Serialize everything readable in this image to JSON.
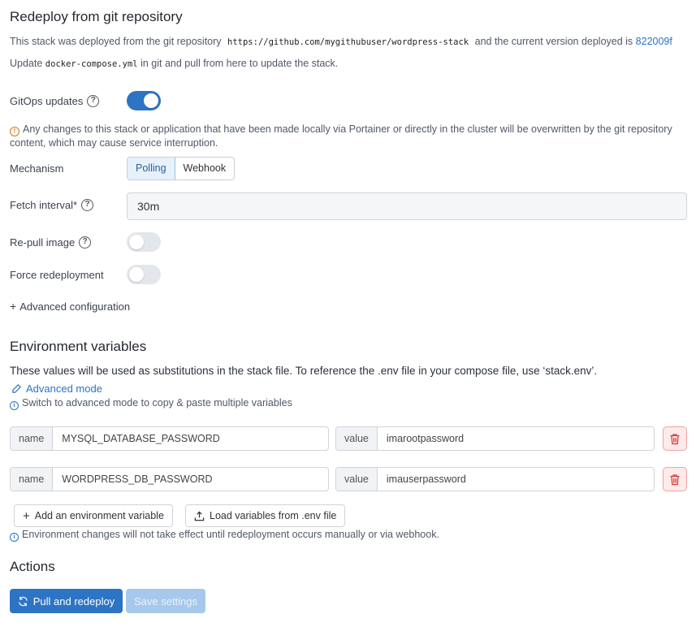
{
  "redeploy": {
    "title": "Redeploy from git repository",
    "deployed_text_1": "This stack was deployed from the git repository",
    "repo_url": "https://github.com/mygithubuser/wordpress-stack",
    "deployed_text_2": "and the current version deployed is",
    "commit": "822009f",
    "update_text_1": "Update",
    "compose_file": "docker-compose.yml",
    "update_text_2": "in git and pull from here to update the stack."
  },
  "gitops": {
    "label": "GitOps updates",
    "enabled": true,
    "warning": "Any changes to this stack or application that have been made locally via Portainer or directly in the cluster will be overwritten by the git repository content, which may cause service interruption."
  },
  "mechanism": {
    "label": "Mechanism",
    "options": [
      "Polling",
      "Webhook"
    ],
    "selected": "Polling"
  },
  "fetch_interval": {
    "label": "Fetch interval*",
    "value": "30m"
  },
  "repull": {
    "label": "Re-pull image",
    "enabled": false
  },
  "force": {
    "label": "Force redeployment",
    "enabled": false
  },
  "advanced_config": {
    "label": "Advanced configuration"
  },
  "env": {
    "title": "Environment variables",
    "description": "These values will be used as substitutions in the stack file. To reference the .env file in your compose file, use ‘stack.env’.",
    "advanced_mode": "Advanced mode",
    "advanced_hint": "Switch to advanced mode to copy & paste multiple variables",
    "name_addon": "name",
    "value_addon": "value",
    "variables": [
      {
        "name": "MYSQL_DATABASE_PASSWORD",
        "value": "imarootpassword"
      },
      {
        "name": "WORDPRESS_DB_PASSWORD",
        "value": "imauserpassword"
      }
    ],
    "add_button": "Add an environment variable",
    "load_button": "Load variables from .env file",
    "note": "Environment changes will not take effect until redeployment occurs manually or via webhook."
  },
  "actions": {
    "title": "Actions",
    "pull_redeploy": "Pull and redeploy",
    "save_settings": "Save settings"
  }
}
